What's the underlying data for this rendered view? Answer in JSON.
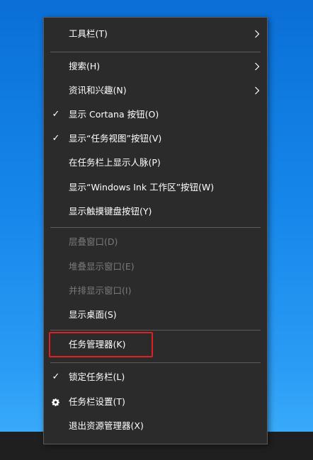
{
  "menu": {
    "items": [
      {
        "label": "工具栏(T)",
        "check": "",
        "chevron": true,
        "disabled": false
      },
      {
        "label": "搜索(H)",
        "check": "",
        "chevron": true,
        "disabled": false
      },
      {
        "label": "资讯和兴趣(N)",
        "check": "",
        "chevron": true,
        "disabled": false
      },
      {
        "label": "显示 Cortana 按钮(O)",
        "check": "✓",
        "chevron": false,
        "disabled": false
      },
      {
        "label": "显示“任务视图”按钮(V)",
        "check": "✓",
        "chevron": false,
        "disabled": false
      },
      {
        "label": "在任务栏上显示人脉(P)",
        "check": "",
        "chevron": false,
        "disabled": false
      },
      {
        "label": "显示“Windows Ink 工作区”按钮(W)",
        "check": "",
        "chevron": false,
        "disabled": false
      },
      {
        "label": "显示触摸键盘按钮(Y)",
        "check": "",
        "chevron": false,
        "disabled": false
      },
      {
        "label": "层叠窗口(D)",
        "check": "",
        "chevron": false,
        "disabled": true
      },
      {
        "label": "堆叠显示窗口(E)",
        "check": "",
        "chevron": false,
        "disabled": true
      },
      {
        "label": "并排显示窗口(I)",
        "check": "",
        "chevron": false,
        "disabled": true
      },
      {
        "label": "显示桌面(S)",
        "check": "",
        "chevron": false,
        "disabled": false
      },
      {
        "label": "任务管理器(K)",
        "check": "",
        "chevron": false,
        "disabled": false
      },
      {
        "label": "锁定任务栏(L)",
        "check": "✓",
        "chevron": false,
        "disabled": false
      },
      {
        "label": "任务栏设置(T)",
        "check": "",
        "icon": "gear-icon",
        "chevron": false,
        "disabled": false
      },
      {
        "label": "退出资源管理器(X)",
        "check": "",
        "chevron": false,
        "disabled": false
      }
    ],
    "highlighted_item": "任务管理器(K)",
    "highlight_color": "#e02020"
  },
  "colors": {
    "menu_background": "#2b2b2b",
    "text": "#ffffff",
    "disabled_text": "#7a7a7a",
    "separator": "#5c5c5c",
    "desktop_blue": "#1687ea"
  }
}
